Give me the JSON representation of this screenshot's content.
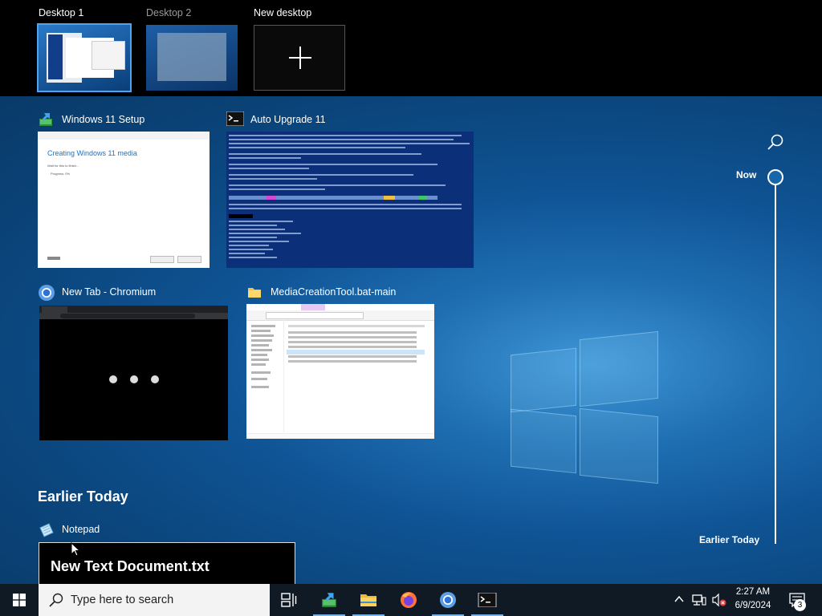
{
  "desktops": [
    {
      "label": "Desktop 1",
      "active": true
    },
    {
      "label": "Desktop 2",
      "active": false
    },
    {
      "label": "New desktop",
      "is_new": true
    }
  ],
  "windows": {
    "setup": {
      "title": "Windows 11 Setup",
      "content_heading": "Creating Windows 11 media",
      "content_subtitle": "Wait for this to finish...",
      "content_progress": "Progress: 0%"
    },
    "terminal": {
      "title": "Auto Upgrade 11"
    },
    "chromium": {
      "title": "New Tab - Chromium"
    },
    "explorer": {
      "title": "MediaCreationTool.bat-main"
    }
  },
  "earlier_today": {
    "heading": "Earlier Today",
    "notepad": {
      "title": "Notepad",
      "content": "New Text Document.txt"
    }
  },
  "timeline": {
    "now_label": "Now",
    "earlier_label": "Earlier Today"
  },
  "taskbar": {
    "search_placeholder": "Type here to search",
    "time": "2:27 AM",
    "date": "6/9/2024",
    "notification_count": "3",
    "apps": [
      "setup-app-icon",
      "file-explorer-icon",
      "firefox-icon",
      "chromium-icon",
      "terminal-icon"
    ]
  },
  "colors": {
    "accent": "#4fa3f0",
    "taskbar": "#101a24",
    "wallpaper": "#0b4f8c",
    "terminal_bg": "#0c2f7a"
  }
}
